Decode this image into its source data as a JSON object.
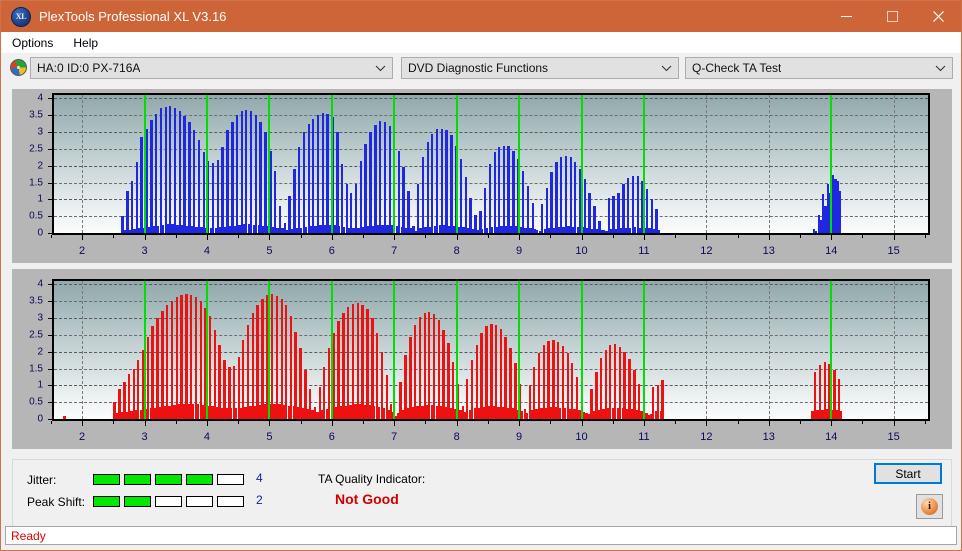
{
  "window": {
    "title": "PlexTools Professional XL V3.16",
    "icon": "xl-app-icon",
    "icon_text": "XL",
    "minimize_label": "—",
    "maximize_label": "□",
    "close_label": "✕",
    "titlebar_color": "#cd6539"
  },
  "menu": {
    "items": [
      {
        "label": "Options"
      },
      {
        "label": "Help"
      }
    ]
  },
  "toolbar": {
    "drive_icon": "disc-icon",
    "drive_select": {
      "value": "HA:0 ID:0  PX-716A",
      "chevron": "⌄"
    },
    "function_select": {
      "value": "DVD Diagnostic Functions",
      "chevron": "⌄"
    },
    "test_select": {
      "value": "Q-Check TA Test",
      "chevron": "⌄"
    }
  },
  "results": {
    "jitter_label": "Jitter:",
    "jitter_value": "4",
    "jitter_filled": 4,
    "jitter_total": 5,
    "peak_shift_label": "Peak Shift:",
    "peak_shift_value": "2",
    "peak_shift_filled": 2,
    "peak_shift_total": 5,
    "ta_title": "TA Quality Indicator:",
    "ta_value": "Not Good",
    "ta_value_color": "#d00000",
    "bar_on_color": "#00e800"
  },
  "actions": {
    "start_label": "Start",
    "info_icon": "info-icon",
    "info_glyph": "i"
  },
  "status": {
    "text": "Ready",
    "color": "#e00000"
  },
  "chart_data": [
    {
      "id": "jitter-chart",
      "type": "bar",
      "title": "",
      "xlabel": "",
      "ylabel": "",
      "color": "#1f27e0",
      "xlim": [
        1.55,
        15.55
      ],
      "ylim": [
        0,
        4.1
      ],
      "yticks": [
        0,
        0.5,
        1,
        1.5,
        2,
        2.5,
        3,
        3.5,
        4
      ],
      "ytick_labels": [
        "0",
        "0.5",
        "1",
        "1.5",
        "2",
        "2.5",
        "3",
        "3.5",
        "4"
      ],
      "xticks": [
        2,
        3,
        4,
        5,
        6,
        7,
        8,
        9,
        10,
        11,
        12,
        13,
        14,
        15
      ],
      "xtick_labels": [
        "2",
        "3",
        "4",
        "5",
        "6",
        "7",
        "8",
        "9",
        "10",
        "11",
        "12",
        "13",
        "14",
        "15"
      ],
      "vgrid_x": [
        2,
        12,
        13,
        15
      ],
      "markers_x": [
        3,
        4,
        5,
        6,
        7,
        8,
        9,
        10,
        11,
        14
      ],
      "grid": true,
      "bar_width": 0.038,
      "x": [
        2.65,
        2.69,
        2.73,
        2.76,
        2.8,
        2.84,
        2.88,
        2.92,
        2.95,
        2.99,
        3.03,
        3.07,
        3.11,
        3.15,
        3.18,
        3.22,
        3.26,
        3.3,
        3.34,
        3.37,
        3.41,
        3.45,
        3.49,
        3.53,
        3.57,
        3.6,
        3.64,
        3.68,
        3.72,
        3.76,
        3.79,
        3.83,
        3.87,
        3.91,
        3.95,
        3.99,
        4.02,
        4.06,
        4.1,
        4.14,
        4.18,
        4.21,
        4.25,
        4.29,
        4.33,
        4.37,
        4.41,
        4.44,
        4.48,
        4.52,
        4.56,
        4.6,
        4.63,
        4.67,
        4.71,
        4.75,
        4.79,
        4.83,
        4.86,
        4.9,
        4.94,
        4.98,
        5.02,
        5.05,
        5.09,
        5.13,
        5.17,
        5.21,
        5.25,
        5.28,
        5.32,
        5.36,
        5.4,
        5.44,
        5.47,
        5.51,
        5.55,
        5.59,
        5.63,
        5.67,
        5.7,
        5.74,
        5.78,
        5.82,
        5.86,
        5.89,
        5.93,
        5.97,
        6.01,
        6.05,
        6.09,
        6.12,
        6.16,
        6.2,
        6.24,
        6.28,
        6.31,
        6.35,
        6.39,
        6.43,
        6.47,
        6.51,
        6.54,
        6.58,
        6.62,
        6.66,
        6.7,
        6.73,
        6.77,
        6.81,
        6.85,
        6.89,
        6.93,
        6.96,
        7.0,
        7.04,
        7.08,
        7.12,
        7.15,
        7.19,
        7.23,
        7.27,
        7.31,
        7.35,
        7.38,
        7.42,
        7.46,
        7.5,
        7.54,
        7.57,
        7.61,
        7.65,
        7.69,
        7.73,
        7.77,
        7.8,
        7.84,
        7.88,
        7.92,
        7.96,
        7.99,
        8.03,
        8.07,
        8.11,
        8.15,
        8.19,
        8.22,
        8.26,
        8.3,
        8.34,
        8.38,
        8.41,
        8.45,
        8.49,
        8.53,
        8.57,
        8.61,
        8.64,
        8.68,
        8.72,
        8.76,
        8.8,
        8.83,
        8.87,
        8.91,
        8.95,
        8.99,
        9.03,
        9.06,
        9.1,
        9.14,
        9.18,
        9.22,
        9.25,
        9.29,
        9.33,
        9.37,
        9.41,
        9.45,
        9.48,
        9.52,
        9.56,
        9.6,
        9.64,
        9.67,
        9.71,
        9.75,
        9.79,
        9.83,
        9.87,
        9.9,
        9.94,
        9.98,
        10.02,
        10.06,
        10.09,
        10.13,
        10.17,
        10.21,
        10.25,
        10.29,
        10.32,
        10.36,
        10.4,
        10.44,
        10.48,
        10.51,
        10.55,
        10.59,
        10.63,
        10.67,
        10.71,
        10.74,
        10.78,
        10.82,
        10.86,
        10.9,
        10.93,
        10.97,
        11.01,
        11.05,
        11.09,
        11.13,
        11.16,
        11.2,
        11.24,
        13.72,
        13.76,
        13.8,
        13.84,
        13.87,
        13.91,
        13.95,
        13.99,
        14.03,
        14.07,
        14.1,
        14.14
      ],
      "values": [
        0.5,
        0.1,
        1.25,
        0.1,
        1.55,
        0.12,
        2.1,
        0.14,
        2.85,
        0.16,
        3.1,
        0.18,
        3.35,
        0.2,
        3.55,
        0.22,
        3.7,
        0.24,
        3.75,
        0.26,
        3.78,
        0.26,
        3.72,
        0.25,
        3.62,
        0.24,
        3.48,
        0.22,
        3.3,
        0.2,
        3.05,
        0.18,
        2.75,
        0.17,
        2.4,
        0.16,
        2.15,
        0.16,
        2.08,
        0.16,
        2.18,
        0.17,
        2.55,
        0.18,
        3.05,
        0.2,
        3.3,
        0.22,
        3.5,
        0.24,
        3.62,
        0.26,
        3.66,
        0.26,
        3.62,
        0.25,
        3.5,
        0.24,
        3.3,
        0.22,
        3.0,
        0.2,
        2.45,
        0.18,
        1.85,
        0.16,
        0.8,
        0.14,
        0.3,
        0.08,
        1.1,
        0.12,
        1.9,
        0.14,
        2.55,
        0.16,
        3.0,
        0.18,
        3.25,
        0.2,
        3.4,
        0.22,
        3.52,
        0.24,
        3.58,
        0.25,
        3.55,
        0.24,
        3.45,
        0.23,
        3.0,
        0.2,
        2.05,
        0.17,
        1.45,
        0.15,
        1.2,
        0.14,
        1.45,
        0.16,
        2.15,
        0.18,
        2.65,
        0.2,
        3.0,
        0.22,
        3.22,
        0.24,
        3.32,
        0.25,
        3.3,
        0.24,
        3.18,
        0.23,
        2.9,
        0.21,
        2.45,
        0.18,
        1.95,
        0.16,
        1.25,
        0.14,
        0.2,
        0.06,
        1.45,
        0.14,
        2.25,
        0.17,
        2.7,
        0.19,
        2.95,
        0.21,
        3.08,
        0.23,
        3.1,
        0.23,
        3.05,
        0.22,
        2.9,
        0.21,
        2.6,
        0.19,
        2.2,
        0.17,
        1.65,
        0.15,
        1.05,
        0.12,
        0.55,
        0.1,
        0.65,
        0.11,
        1.35,
        0.14,
        2.05,
        0.17,
        2.4,
        0.19,
        2.55,
        0.21,
        2.6,
        0.22,
        2.58,
        0.21,
        2.45,
        0.2,
        2.2,
        0.18,
        1.85,
        0.16,
        1.4,
        0.14,
        0.9,
        0.12,
        0.1,
        0.05,
        0.85,
        0.12,
        1.35,
        0.14,
        1.8,
        0.16,
        2.1,
        0.18,
        2.25,
        0.19,
        2.3,
        0.2,
        2.25,
        0.19,
        2.12,
        0.18,
        1.9,
        0.17,
        1.6,
        0.15,
        1.2,
        0.13,
        0.8,
        0.11,
        0.35,
        0.08,
        0.1,
        0.05,
        1.05,
        0.13,
        1.1,
        0.13,
        1.2,
        0.14,
        1.45,
        0.15,
        1.62,
        0.16,
        1.7,
        0.17,
        1.68,
        0.16,
        1.55,
        0.15,
        1.3,
        0.14,
        1.0,
        0.12,
        0.7,
        0.1,
        0.12,
        0.05,
        0.55,
        0.4,
        1.15,
        0.8,
        1.45,
        1.2,
        1.72,
        1.6,
        1.55,
        1.25,
        1.2,
        0.22
      ]
    },
    {
      "id": "peak-shift-chart",
      "type": "bar",
      "title": "",
      "xlabel": "",
      "ylabel": "",
      "color": "#ee1111",
      "xlim": [
        1.55,
        15.55
      ],
      "ylim": [
        0,
        4.1
      ],
      "yticks": [
        0,
        0.5,
        1,
        1.5,
        2,
        2.5,
        3,
        3.5,
        4
      ],
      "ytick_labels": [
        "0",
        "0.5",
        "1",
        "1.5",
        "2",
        "2.5",
        "3",
        "3.5",
        "4"
      ],
      "xticks": [
        2,
        3,
        4,
        5,
        6,
        7,
        8,
        9,
        10,
        11,
        12,
        13,
        14,
        15
      ],
      "xtick_labels": [
        "2",
        "3",
        "4",
        "5",
        "6",
        "7",
        "8",
        "9",
        "10",
        "11",
        "12",
        "13",
        "14",
        "15"
      ],
      "vgrid_x": [
        2,
        12,
        13,
        15
      ],
      "markers_x": [
        3,
        4,
        5,
        6,
        7,
        8,
        9,
        10,
        11,
        14
      ],
      "grid": true,
      "bar_width": 0.038,
      "x": [
        1.72,
        2.52,
        2.56,
        2.6,
        2.64,
        2.68,
        2.71,
        2.75,
        2.79,
        2.83,
        2.87,
        2.9,
        2.94,
        2.98,
        3.02,
        3.06,
        3.1,
        3.13,
        3.17,
        3.21,
        3.25,
        3.29,
        3.32,
        3.36,
        3.4,
        3.44,
        3.48,
        3.52,
        3.55,
        3.59,
        3.63,
        3.67,
        3.71,
        3.74,
        3.78,
        3.82,
        3.86,
        3.9,
        3.94,
        3.97,
        4.01,
        4.05,
        4.09,
        4.13,
        4.16,
        4.2,
        4.24,
        4.28,
        4.32,
        4.36,
        4.39,
        4.43,
        4.47,
        4.51,
        4.55,
        4.58,
        4.62,
        4.66,
        4.7,
        4.74,
        4.78,
        4.81,
        4.85,
        4.89,
        4.93,
        4.97,
        5.0,
        5.04,
        5.08,
        5.12,
        5.16,
        5.2,
        5.23,
        5.27,
        5.31,
        5.35,
        5.39,
        5.42,
        5.46,
        5.5,
        5.54,
        5.58,
        5.62,
        5.65,
        5.69,
        5.73,
        5.77,
        5.81,
        5.84,
        5.88,
        5.92,
        5.96,
        6.0,
        6.04,
        6.07,
        6.11,
        6.15,
        6.19,
        6.23,
        6.26,
        6.3,
        6.34,
        6.38,
        6.42,
        6.46,
        6.49,
        6.53,
        6.57,
        6.61,
        6.65,
        6.68,
        6.72,
        6.76,
        6.8,
        6.84,
        6.88,
        6.91,
        6.95,
        6.99,
        7.03,
        7.07,
        7.1,
        7.14,
        7.18,
        7.22,
        7.26,
        7.3,
        7.33,
        7.37,
        7.41,
        7.45,
        7.49,
        7.52,
        7.56,
        7.6,
        7.64,
        7.68,
        7.72,
        7.75,
        7.79,
        7.83,
        7.87,
        7.91,
        7.94,
        7.98,
        8.02,
        8.06,
        8.1,
        8.14,
        8.17,
        8.21,
        8.25,
        8.29,
        8.33,
        8.36,
        8.4,
        8.44,
        8.48,
        8.52,
        8.56,
        8.59,
        8.63,
        8.67,
        8.71,
        8.75,
        8.78,
        8.82,
        8.86,
        8.9,
        8.94,
        8.98,
        9.01,
        9.05,
        9.09,
        9.13,
        9.17,
        9.2,
        9.24,
        9.28,
        9.32,
        9.36,
        9.4,
        9.43,
        9.47,
        9.51,
        9.55,
        9.59,
        9.62,
        9.66,
        9.7,
        9.74,
        9.78,
        9.82,
        9.85,
        9.89,
        9.93,
        9.97,
        10.01,
        10.04,
        10.08,
        10.12,
        10.16,
        10.2,
        10.24,
        10.27,
        10.31,
        10.35,
        10.39,
        10.43,
        10.46,
        10.5,
        10.54,
        10.58,
        10.62,
        10.66,
        10.69,
        10.73,
        10.77,
        10.81,
        10.85,
        10.88,
        10.92,
        10.96,
        11.0,
        11.04,
        11.08,
        11.11,
        11.15,
        11.19,
        11.23,
        11.27,
        11.3,
        13.7,
        13.74,
        13.78,
        13.82,
        13.86,
        13.9,
        13.93,
        13.97,
        14.01,
        14.05,
        14.09,
        14.12,
        14.16
      ],
      "values": [
        0.08,
        0.52,
        0.18,
        0.9,
        0.2,
        1.1,
        0.22,
        1.35,
        0.24,
        1.5,
        0.26,
        1.75,
        0.28,
        2.05,
        0.3,
        2.45,
        0.32,
        2.75,
        0.34,
        3.0,
        0.36,
        3.2,
        0.38,
        3.4,
        0.4,
        3.52,
        0.42,
        3.62,
        0.44,
        3.68,
        0.46,
        3.7,
        0.46,
        3.68,
        0.45,
        3.62,
        0.44,
        3.5,
        0.42,
        3.3,
        0.4,
        3.05,
        0.38,
        2.65,
        0.36,
        2.2,
        0.34,
        1.75,
        0.32,
        1.55,
        0.32,
        1.58,
        0.32,
        1.85,
        0.34,
        2.35,
        0.36,
        2.8,
        0.38,
        3.15,
        0.4,
        3.4,
        0.42,
        3.58,
        0.44,
        3.68,
        0.45,
        3.7,
        0.45,
        3.66,
        0.44,
        3.56,
        0.42,
        3.38,
        0.4,
        3.05,
        0.38,
        2.6,
        0.36,
        2.1,
        0.34,
        1.45,
        0.3,
        0.9,
        0.26,
        0.35,
        0.2,
        0.95,
        0.26,
        1.55,
        0.3,
        2.1,
        0.34,
        2.55,
        0.36,
        2.9,
        0.38,
        3.15,
        0.4,
        3.32,
        0.42,
        3.42,
        0.44,
        3.45,
        0.44,
        3.4,
        0.43,
        3.28,
        0.42,
        3.0,
        0.4,
        2.55,
        0.36,
        2.0,
        0.32,
        1.3,
        0.28,
        0.45,
        0.22,
        0.1,
        0.18,
        1.1,
        0.28,
        1.9,
        0.32,
        2.45,
        0.36,
        2.8,
        0.38,
        3.02,
        0.4,
        3.15,
        0.41,
        3.18,
        0.41,
        3.12,
        0.4,
        2.95,
        0.38,
        2.65,
        0.36,
        2.25,
        0.32,
        1.7,
        0.3,
        1.05,
        0.26,
        0.4,
        0.2,
        1.2,
        0.28,
        1.75,
        0.32,
        2.2,
        0.34,
        2.55,
        0.36,
        2.75,
        0.38,
        2.82,
        0.38,
        2.8,
        0.37,
        2.68,
        0.36,
        2.45,
        0.34,
        2.1,
        0.32,
        1.65,
        0.28,
        1.05,
        0.24,
        0.3,
        0.18,
        1.0,
        0.26,
        1.55,
        0.3,
        1.95,
        0.32,
        2.2,
        0.34,
        2.32,
        0.35,
        2.35,
        0.35,
        2.3,
        0.34,
        2.18,
        0.33,
        1.95,
        0.31,
        1.65,
        0.29,
        1.25,
        0.26,
        0.75,
        0.22,
        0.18,
        0.15,
        0.9,
        0.24,
        1.4,
        0.28,
        1.8,
        0.3,
        2.05,
        0.32,
        2.2,
        0.33,
        2.22,
        0.33,
        2.15,
        0.32,
        2.0,
        0.31,
        1.78,
        0.29,
        1.45,
        0.26,
        1.05,
        0.23,
        0.55,
        0.18,
        0.12,
        0.14,
        0.95,
        0.23,
        1.0,
        0.24,
        1.15,
        0.25,
        1.4,
        0.27,
        1.6,
        0.28,
        1.68,
        0.29,
        1.62,
        0.28,
        1.45,
        0.27,
        1.18,
        0.25,
        0.85,
        0.22,
        0.45,
        0.18,
        0.55,
        0.12,
        0.5,
        0.35,
        0.95,
        0.75,
        1.35,
        1.1,
        1.62,
        1.45,
        1.4,
        1.15,
        1.0,
        0.6,
        0.15
      ]
    }
  ]
}
